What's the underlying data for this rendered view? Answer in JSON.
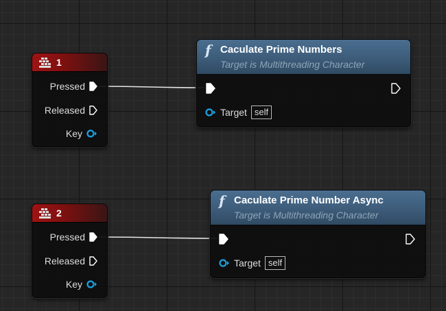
{
  "event_nodes": [
    {
      "title": "1",
      "pins": {
        "pressed": "Pressed",
        "released": "Released",
        "key": "Key"
      }
    },
    {
      "title": "2",
      "pins": {
        "pressed": "Pressed",
        "released": "Released",
        "key": "Key"
      }
    }
  ],
  "function_nodes": [
    {
      "title": "Caculate Prime Numbers",
      "subtitle": "Target is Multithreading Character",
      "target_label": "Target",
      "target_value": "self"
    },
    {
      "title": "Caculate Prime Number Async",
      "subtitle": "Target is Multithreading Character",
      "target_label": "Target",
      "target_value": "self"
    }
  ],
  "icons": {
    "event_icon": "keyboard-key-icon",
    "function_icon": "function-icon",
    "exec_pin": "exec-pin-icon",
    "object_pin": "object-pin-icon"
  },
  "colors": {
    "event_header": "#a01313",
    "function_header": "#4a6e8f",
    "object_pin": "#1aa3e6",
    "wire": "#ffffff"
  }
}
